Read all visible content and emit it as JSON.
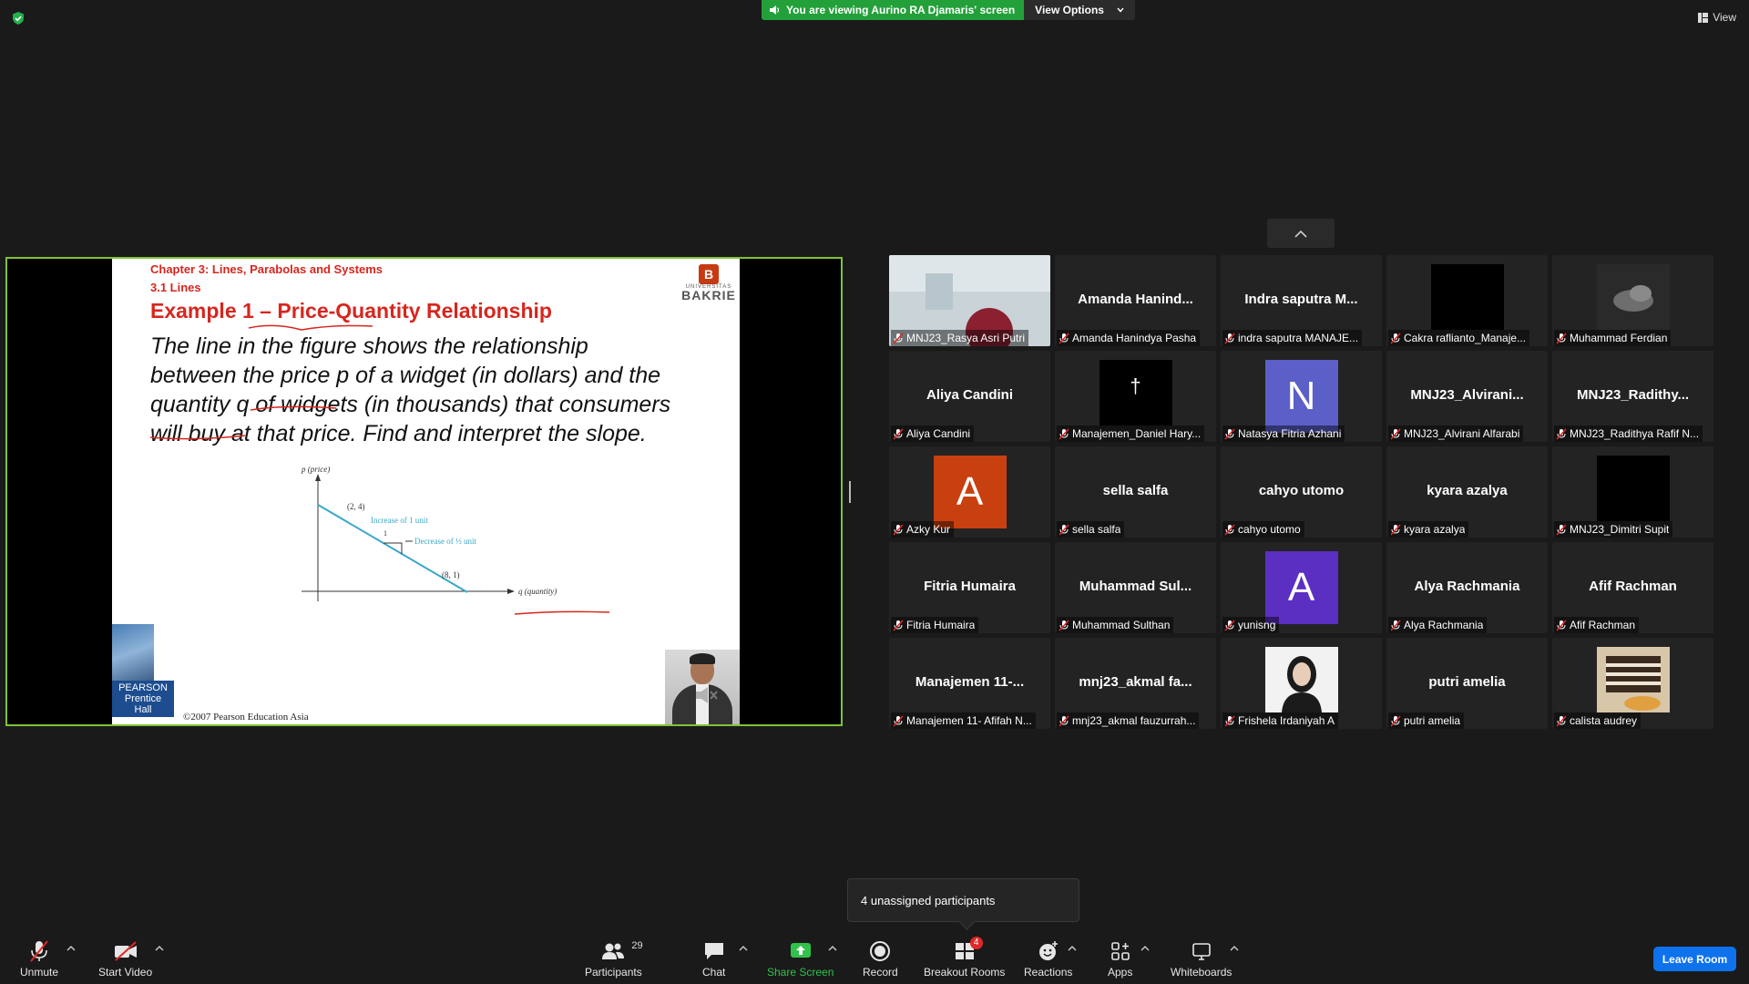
{
  "top": {
    "viewing_text": "You are viewing Aurino RA Djamaris' screen",
    "view_options_label": "View Options",
    "view_label": "View",
    "viewing_color": "#23a03a"
  },
  "slide": {
    "chapter": "Chapter 3: Lines, Parabolas and Systems",
    "section": "3.1 Lines",
    "logo_small": "UNIVERSITAS",
    "logo_name": "BAKRIE",
    "example_title": "Example 1 – Price-Quantity Relationship",
    "body_lines": [
      "The line in the figure shows the relationship",
      "between the price p of a widget (in dollars) and the",
      "quantity q of widgets (in thousands) that consumers",
      "will buy at that price. Find and interpret the slope."
    ],
    "graph": {
      "y_axis": "p (price)",
      "x_axis": "q (quantity)",
      "point1": "(2, 4)",
      "point2": "(8, 1)",
      "inc_label": "Increase of 1 unit",
      "dec_label": "Decrease of ½ unit",
      "one": "1"
    },
    "publisher": "PEARSON",
    "imprint_1": "Prentice",
    "imprint_2": "Hall",
    "copyright": "©2007 Pearson Education Asia"
  },
  "participants": [
    {
      "display": "",
      "name": "MNJ23_Rasya Asri Putri",
      "kind": "photo",
      "photo": "room"
    },
    {
      "display": "Amanda  Hanind...",
      "name": "Amanda Hanindya Pasha",
      "kind": "text"
    },
    {
      "display": "Indra saputra M...",
      "name": "indra saputra MANAJE...",
      "kind": "text"
    },
    {
      "display": "",
      "name": "Cakra raflianto_Manaje...",
      "kind": "photo",
      "photo": "black"
    },
    {
      "display": "",
      "name": "Muhammad Ferdian",
      "kind": "photo",
      "photo": "cloud"
    },
    {
      "display": "Aliya Candini",
      "name": "Aliya Candini",
      "kind": "text"
    },
    {
      "display": "",
      "name": "Manajemen_Daniel Hary...",
      "kind": "photo",
      "photo": "cross",
      "glyph": "†"
    },
    {
      "display": "",
      "name": "Natasya Fitria Azhani",
      "kind": "avatar",
      "letter": "N",
      "color": "#5b5fc7"
    },
    {
      "display": "MNJ23_Alvirani...",
      "name": "MNJ23_Alvirani Alfarabi",
      "kind": "text"
    },
    {
      "display": "MNJ23_Radithy...",
      "name": "MNJ23_Radithya Rafif N...",
      "kind": "text"
    },
    {
      "display": "",
      "name": "Azky Kur",
      "kind": "avatar",
      "letter": "A",
      "color": "#c8400f"
    },
    {
      "display": "sella salfa",
      "name": "sella salfa",
      "kind": "text"
    },
    {
      "display": "cahyo utomo",
      "name": "cahyo utomo",
      "kind": "text"
    },
    {
      "display": "kyara azalya",
      "name": "kyara azalya",
      "kind": "text"
    },
    {
      "display": "",
      "name": "MNJ23_Dimitri Supit",
      "kind": "photo",
      "photo": "black"
    },
    {
      "display": "Fitria Humaira",
      "name": "Fitria Humaira",
      "kind": "text"
    },
    {
      "display": "Muhammad  Sul...",
      "name": "Muhammad Sulthan",
      "kind": "text"
    },
    {
      "display": "",
      "name": "yunisng",
      "kind": "avatar",
      "letter": "A",
      "color": "#5a2fc2"
    },
    {
      "display": "Alya Rachmania",
      "name": "Alya Rachmania",
      "kind": "text"
    },
    {
      "display": "Afif Rachman",
      "name": "Afif Rachman",
      "kind": "text"
    },
    {
      "display": "Manajemen  11-...",
      "name": "Manajemen 11- Afifah N...",
      "kind": "text"
    },
    {
      "display": "mnj23_akmal  fa...",
      "name": "mnj23_akmal fauzurrah...",
      "kind": "text"
    },
    {
      "display": "",
      "name": "Frishela Irdaniyah A",
      "kind": "photo",
      "photo": "portrait"
    },
    {
      "display": "putri amelia",
      "name": "putri amelia",
      "kind": "text"
    },
    {
      "display": "",
      "name": "calista audrey",
      "kind": "photo",
      "photo": "food"
    }
  ],
  "tooltip": "4 unassigned participants",
  "toolbar": {
    "unmute": "Unmute",
    "start_video": "Start Video",
    "participants": "Participants",
    "participants_count": "29",
    "chat": "Chat",
    "share_screen": "Share Screen",
    "record": "Record",
    "breakout_rooms": "Breakout Rooms",
    "breakout_badge": "4",
    "reactions": "Reactions",
    "apps": "Apps",
    "whiteboards": "Whiteboards",
    "leave": "Leave Room"
  }
}
